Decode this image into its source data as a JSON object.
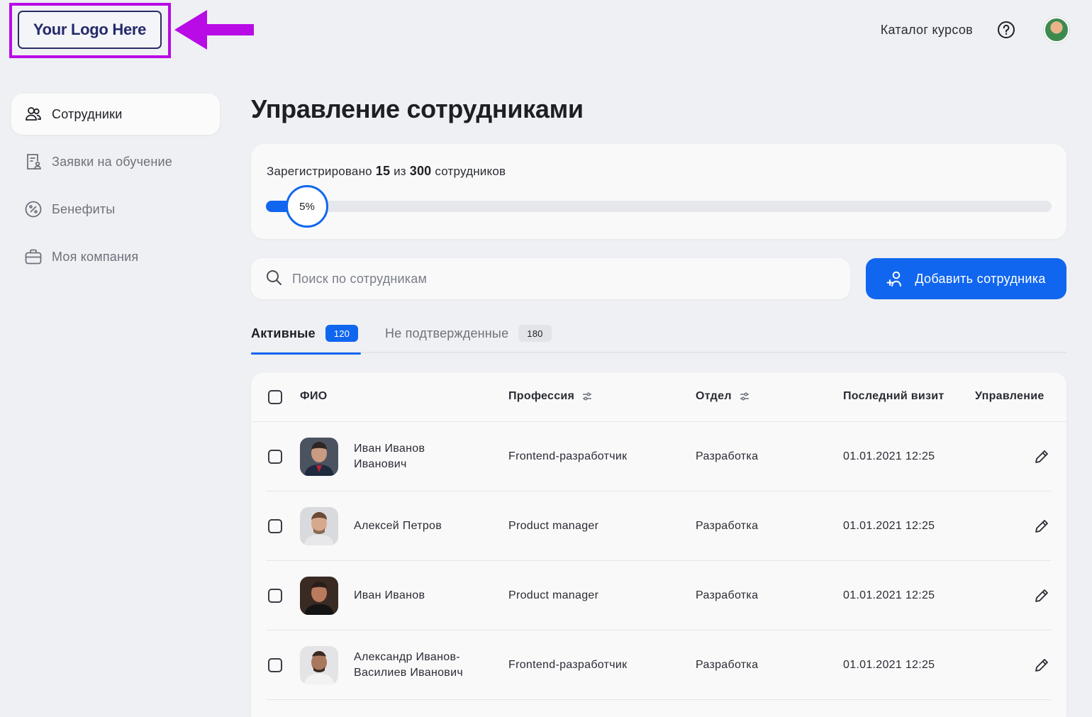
{
  "header": {
    "logo_text": "Your Logo Here",
    "catalog_link": "Каталог курсов",
    "help_icon": "question-circle-icon",
    "avatar": "user-avatar"
  },
  "colors": {
    "accent": "#1166f0",
    "logo_highlight": "#b80be6",
    "background": "#eff0f3",
    "card": "#f9f9fa"
  },
  "sidebar": {
    "items": [
      {
        "label": "Сотрудники",
        "icon": "users-icon",
        "active": true
      },
      {
        "label": "Заявки на обучение",
        "icon": "document-user-icon",
        "active": false
      },
      {
        "label": "Бенефиты",
        "icon": "percent-badge-icon",
        "active": false
      },
      {
        "label": "Моя компания",
        "icon": "briefcase-icon",
        "active": false
      }
    ]
  },
  "main": {
    "title": "Управление сотрудниками",
    "progress": {
      "prefix": "Зарегистрировано",
      "registered": "15",
      "middle": "из",
      "total": "300",
      "suffix": "сотрудников",
      "percent_label": "5%",
      "fraction": 0.05
    },
    "search": {
      "placeholder": "Поиск по сотрудникам",
      "value": ""
    },
    "add_button": "Добавить сотрудника",
    "tabs": [
      {
        "label": "Активные",
        "count": "120",
        "active": true
      },
      {
        "label": "Не подтвержденные",
        "count": "180",
        "active": false
      }
    ],
    "table": {
      "columns": {
        "name": "ФИО",
        "profession": "Профессия",
        "department": "Отдел",
        "last_visit": "Последний визит",
        "actions": "Управление"
      },
      "rows": [
        {
          "name_line1": "Иван Иванов",
          "name_line2": "Иванович",
          "profession": "Frontend-разработчик",
          "department": "Разработка",
          "last_visit": "01.01.2021 12:25"
        },
        {
          "name_line1": "Алексей Петров",
          "name_line2": "",
          "profession": "Product manager",
          "department": "Разработка",
          "last_visit": "01.01.2021 12:25"
        },
        {
          "name_line1": "Иван Иванов",
          "name_line2": "",
          "profession": "Product manager",
          "department": "Разработка",
          "last_visit": "01.01.2021 12:25"
        },
        {
          "name_line1": "Александр Иванов-",
          "name_line2": "Василиев Иванович",
          "profession": "Frontend-разработчик",
          "department": "Разработка",
          "last_visit": "01.01.2021 12:25"
        }
      ]
    }
  }
}
